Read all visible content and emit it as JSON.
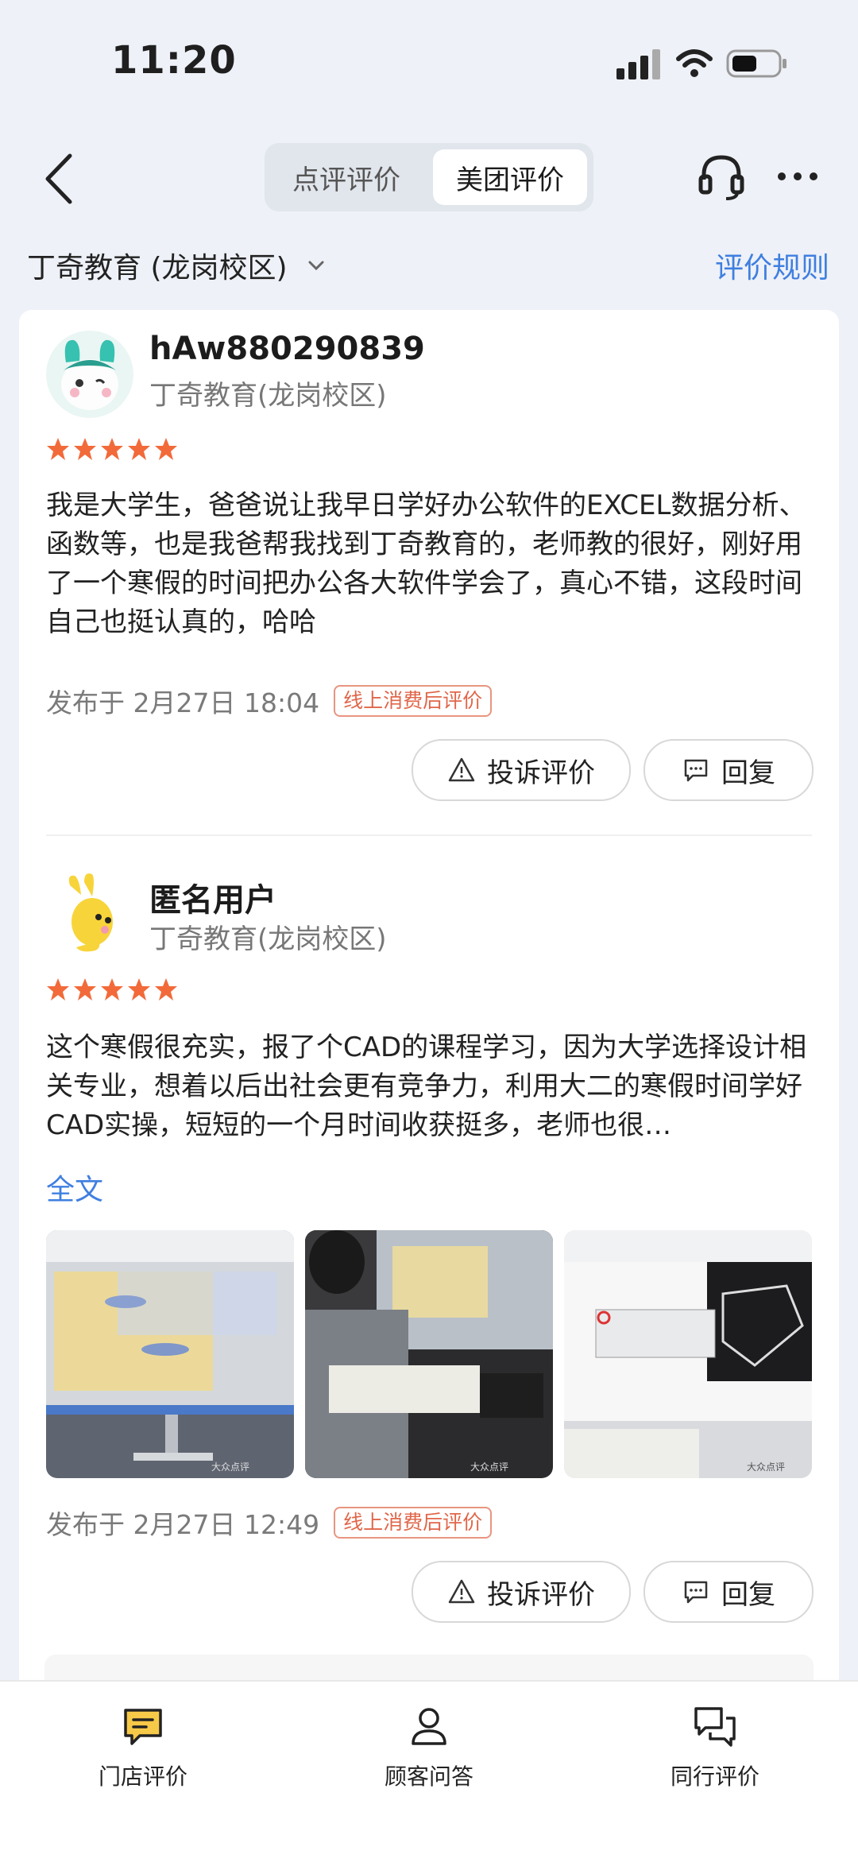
{
  "status_bar": {
    "time": "11:20"
  },
  "nav": {
    "tabs": [
      {
        "label": "点评评价",
        "active": false
      },
      {
        "label": "美团评价",
        "active": true
      }
    ]
  },
  "shop": {
    "name": "丁奇教育 (龙岗校区)",
    "rules_label": "评价规则"
  },
  "reviews": [
    {
      "username": "hAw880290839",
      "shop": "丁奇教育(龙岗校区)",
      "rating": 5,
      "content": "我是大学生，爸爸说让我早日学好办公软件的EXCEL数据分析、函数等，也是我爸帮我找到丁奇教育的，老师教的很好，刚好用了一个寒假的时间把办公各大软件学会了，真心不错，这段时间自己也挺认真的，哈哈",
      "published": "发布于 2月27日 18:04",
      "tag": "线上消费后评价",
      "complain_label": "投诉评价",
      "reply_label": "回复"
    },
    {
      "username": "匿名用户",
      "shop": "丁奇教育(龙岗校区)",
      "rating": 5,
      "content": "这个寒假很充实，报了个CAD的课程学习，因为大学选择设计相关专业，想着以后出社会更有竞争力，利用大二的寒假时间学好CAD实操，短短的一个月时间收获挺多，老师也很…",
      "fulltext_label": "全文",
      "photo_watermark": "大众点评",
      "published": "发布于 2月27日 12:49",
      "tag": "线上消费后评价",
      "complain_label": "投诉评价",
      "reply_label": "回复"
    }
  ],
  "tabbar": [
    {
      "label": "门店评价",
      "icon": "comment-icon",
      "active": true
    },
    {
      "label": "顾客问答",
      "icon": "person-icon",
      "active": false
    },
    {
      "label": "同行评价",
      "icon": "chat-bubbles-icon",
      "active": false
    }
  ],
  "colors": {
    "accent": "#3f7fe0",
    "star": "#f26a3a",
    "tag": "#e0664a",
    "active_tab_icon": "#f7c948"
  }
}
